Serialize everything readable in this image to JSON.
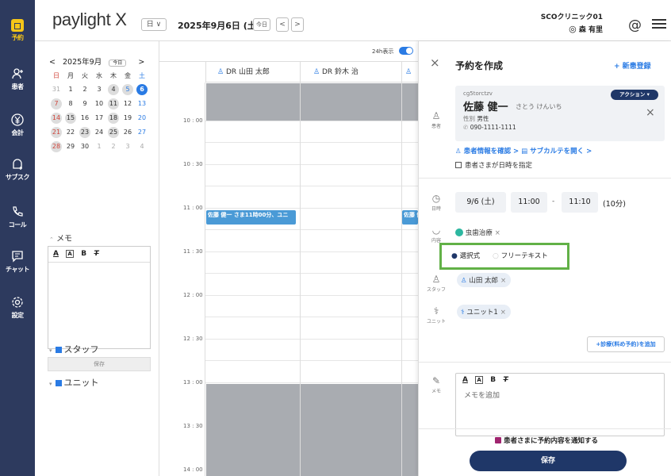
{
  "nav": {
    "items": [
      {
        "label": "予約",
        "icon": "calendar-icon"
      },
      {
        "label": "患者",
        "icon": "person-add-icon"
      },
      {
        "label": "会計",
        "icon": "yen-icon"
      },
      {
        "label": "サブスク",
        "icon": "subscribe-icon"
      },
      {
        "label": "コール",
        "icon": "phone-icon"
      },
      {
        "label": "チャット",
        "icon": "chat-icon"
      },
      {
        "label": "設定",
        "icon": "gear-icon"
      }
    ]
  },
  "header": {
    "logo": "paylight X",
    "view_select": "日",
    "date": "2025年9月6日 (土)",
    "today": "今日",
    "prev": "<",
    "next": ">",
    "clinic": "SCOクリニック01",
    "user": "森 有里",
    "at": "@"
  },
  "mini_cal": {
    "month": "2025年9月",
    "today": "今日",
    "prev": "<",
    "next": ">",
    "weekdays": [
      "日",
      "月",
      "火",
      "水",
      "木",
      "金",
      "土"
    ],
    "rows": [
      [
        "31",
        "1",
        "2",
        "3",
        "4",
        "5",
        "6"
      ],
      [
        "7",
        "8",
        "9",
        "10",
        "11",
        "12",
        "13"
      ],
      [
        "14",
        "15",
        "16",
        "17",
        "18",
        "19",
        "20"
      ],
      [
        "21",
        "22",
        "23",
        "24",
        "25",
        "26",
        "27"
      ],
      [
        "28",
        "29",
        "30",
        "1",
        "2",
        "3",
        "4"
      ]
    ]
  },
  "memo": {
    "title": "メモ",
    "toolbar": [
      "A",
      "A",
      "B",
      "T"
    ],
    "save": "保存"
  },
  "sections": {
    "staff": "スタッフ",
    "unit": "ユニット"
  },
  "grid": {
    "toggle_label": "24h表示",
    "columns": [
      "DR 山田 太郎",
      "DR 鈴木 治",
      "DR"
    ],
    "times": [
      "10 : 00",
      "10 : 30",
      "11 : 00",
      "11 : 30",
      "12 : 00",
      "12 : 30",
      "13 : 00",
      "13 : 30",
      "14 : 00"
    ],
    "appt_text": "佐藤 健一 さま11時00分、ユニ",
    "appt_text2": "佐藤 健"
  },
  "panel": {
    "title": "予約を作成",
    "close": "×",
    "new_patient": "+ 新患登録",
    "patient": {
      "id": "cg5torctzv",
      "name": "佐藤 健一",
      "kana": "さとう けんいち",
      "gender_label": "性別",
      "gender": "男性",
      "phone": "090-1111-1111",
      "action": "アクション ▾",
      "close": "×"
    },
    "patient_link": "患者情報を確認 >",
    "subkarte_link": "サブカルテを開く >",
    "patient_specify": "患者さまが日時を指定",
    "datetime": {
      "date": "9/6 (土)",
      "start": "11:00",
      "sep": "-",
      "end": "11:10",
      "duration": "(10分)",
      "label": "日時"
    },
    "content": {
      "chip": "虫歯治療",
      "label": "内容"
    },
    "mode": {
      "selected": "選択式",
      "other": "フリーテキスト"
    },
    "staff": {
      "chip": "山田 太郎",
      "label": "スタッフ"
    },
    "unit": {
      "chip": "ユニット1",
      "label": "ユニット"
    },
    "add_treatment": "+診療(料め予約)を追加",
    "memo": {
      "placeholder": "メモを追加",
      "label": "メモ",
      "toolbar": [
        "A",
        "A",
        "B",
        "T"
      ]
    },
    "notify": "患者さまに予約内容を通知する",
    "save": "保存"
  },
  "colors": {
    "nav": "#2d3a5e",
    "accent": "#2a7be4",
    "highlight": "#62b147",
    "save": "#1f3768"
  }
}
